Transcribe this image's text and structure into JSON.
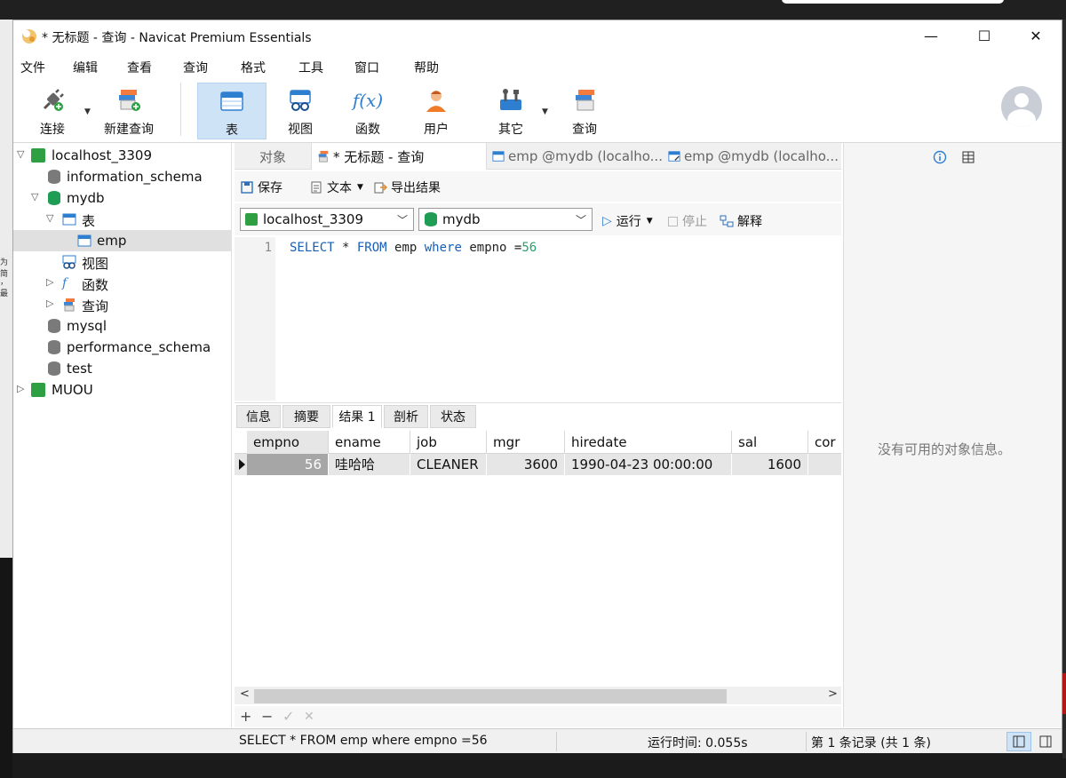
{
  "window": {
    "title": "* 无标题 - 查询 - Navicat Premium Essentials",
    "minimize": "—",
    "maximize": "☐",
    "close": "✕"
  },
  "menu": [
    "文件",
    "编辑",
    "查看",
    "查询",
    "格式",
    "工具",
    "窗口",
    "帮助"
  ],
  "toolbar": {
    "connect": "连接",
    "new_query": "新建查询",
    "table": "表",
    "view": "视图",
    "function": "函数",
    "user": "用户",
    "other": "其它",
    "query": "查询",
    "function_glyph": "f(x)"
  },
  "tree": {
    "conn1": "localhost_3309",
    "db_info": "information_schema",
    "db_mydb": "mydb",
    "folder_tables": "表",
    "table_emp": "emp",
    "folder_views": "视图",
    "folder_functions": "函数",
    "folder_queries": "查询",
    "db_mysql": "mysql",
    "db_perf": "performance_schema",
    "db_test": "test",
    "conn2": "MUOU"
  },
  "tabs": {
    "objects": "对象",
    "query": "* 无标题 - 查询",
    "emp1": "emp @mydb (localho...",
    "emp2": "emp @mydb (localho..."
  },
  "query_toolbar": {
    "save": "保存",
    "text": "文本",
    "export": "导出结果"
  },
  "connection_bar": {
    "connection": "localhost_3309",
    "database": "mydb",
    "run": "运行",
    "stop": "停止",
    "explain": "解释"
  },
  "editor": {
    "line_no": "1",
    "kw_select": "SELECT",
    "star": " * ",
    "kw_from": "FROM",
    "table": " emp ",
    "kw_where": "where",
    "cond": " empno =",
    "value": "56"
  },
  "result_tabs": [
    "信息",
    "摘要",
    "结果 1",
    "剖析",
    "状态"
  ],
  "grid": {
    "columns": [
      "empno",
      "ename",
      "job",
      "mgr",
      "hiredate",
      "sal",
      "cor"
    ],
    "row": [
      "56",
      "哇哈哈",
      "CLEANER",
      "3600",
      "1990-04-23 00:00:00",
      "1600",
      ""
    ]
  },
  "grid_toolbar": {
    "add": "+",
    "remove": "−",
    "apply": "✓",
    "discard": "✕"
  },
  "right_panel": {
    "message": "没有可用的对象信息。"
  },
  "status": {
    "sql": "SELECT * FROM emp where empno =56",
    "time": "运行时间: 0.055s",
    "records": "第 1 条记录 (共 1 条)"
  },
  "desktop_left_text": [
    "为简",
    "，最"
  ]
}
